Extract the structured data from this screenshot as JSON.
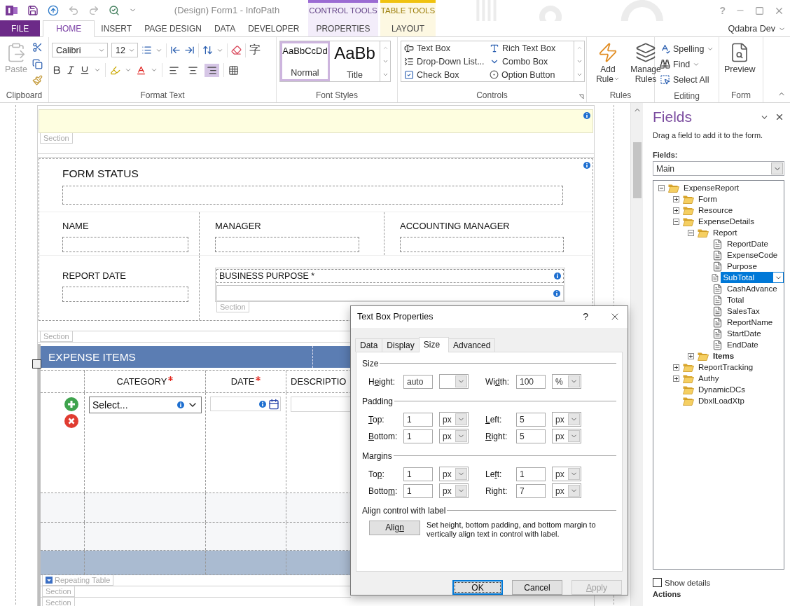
{
  "title_bar": {
    "title": "(Design) Form1 - InfoPath",
    "help": "?",
    "quick_access": [
      {
        "kind": "save",
        "disabled": false
      },
      {
        "kind": "publish",
        "disabled": false
      },
      {
        "kind": "undo",
        "disabled": true
      },
      {
        "kind": "redo",
        "disabled": true
      },
      {
        "kind": "inspect",
        "disabled": false
      }
    ]
  },
  "tabs": [
    {
      "label": "FILE",
      "kind": "file",
      "selected": false
    },
    {
      "label": "HOME",
      "kind": "plain",
      "selected": true
    },
    {
      "label": "INSERT",
      "kind": "plain",
      "selected": false
    },
    {
      "label": "PAGE DESIGN",
      "kind": "plain",
      "selected": false
    },
    {
      "label": "DATA",
      "kind": "plain",
      "selected": false
    },
    {
      "label": "DEVELOPER",
      "kind": "plain",
      "selected": false
    }
  ],
  "contextual_groups": [
    {
      "label": "CONTROL TOOLS",
      "color": "#9b6bd3",
      "tabs": [
        {
          "label": "PROPERTIES",
          "selected": false
        }
      ]
    },
    {
      "label": "TABLE TOOLS",
      "color": "#f0c20f",
      "tabs": [
        {
          "label": "LAYOUT",
          "selected": false
        }
      ]
    }
  ],
  "user": "Qdabra Dev",
  "ribbon": {
    "clipboard": {
      "label": "Clipboard",
      "paste": {
        "label": "Paste",
        "disabled": true
      }
    },
    "format_text": {
      "label": "Format Text",
      "font": "Calibri",
      "size": "12",
      "cjk_glyph": "字",
      "alignments": [
        {
          "kind": "left",
          "selected": false
        },
        {
          "kind": "center",
          "selected": false
        },
        {
          "kind": "right",
          "selected": true
        }
      ]
    },
    "font_styles": {
      "label": "Font Styles",
      "styles": [
        {
          "sample": "AaBbCcDd",
          "label": "Normal",
          "kind": "normal",
          "selected": true
        },
        {
          "sample": "AaBb",
          "label": "Title",
          "kind": "title",
          "selected": false
        }
      ]
    },
    "controls": {
      "label": "Controls",
      "items": [
        {
          "label": "Text Box",
          "kind": "textbox"
        },
        {
          "label": "Rich Text Box",
          "kind": "richtext"
        },
        {
          "label": "Drop-Down List...",
          "kind": "dropdown"
        },
        {
          "label": "Combo Box",
          "kind": "combo"
        },
        {
          "label": "Check Box",
          "kind": "checkbox"
        },
        {
          "label": "Option Button",
          "kind": "option"
        }
      ]
    },
    "rules": {
      "label": "Rules",
      "items": [
        {
          "label": "Add Rule",
          "kind": "add",
          "dropdown": true
        },
        {
          "label": "Manage Rules",
          "kind": "manage",
          "dropdown": false
        }
      ]
    },
    "editing": {
      "label": "Editing",
      "items": [
        {
          "label": "Spelling",
          "kind": "spelling",
          "dropdown": true
        },
        {
          "label": "Find",
          "kind": "find",
          "dropdown": true
        },
        {
          "label": "Select All",
          "kind": "select",
          "dropdown": false
        }
      ]
    },
    "form": {
      "label": "Form",
      "preview": "Preview"
    }
  },
  "form": {
    "top_tag": "Section",
    "status": {
      "title": "FORM STATUS",
      "fields": [
        {
          "label": "NAME"
        },
        {
          "label": "MANAGER"
        },
        {
          "label": "ACCOUNTING MANAGER"
        }
      ],
      "report_date": "REPORT DATE",
      "purpose_label": "BUSINESS PURPOSE *",
      "purpose_tag": "Section",
      "tag": "Section"
    },
    "expense_table": {
      "title": "EXPENSE ITEMS",
      "columns": [
        {
          "label": "CATEGORY",
          "required": true
        },
        {
          "label": "DATE",
          "required": true
        },
        {
          "label": "DESCRIPTIO",
          "required": false
        }
      ],
      "category_value": "Select...",
      "tags": [
        "Repeating Table",
        "Section",
        "Section"
      ]
    }
  },
  "dialog": {
    "title": "Text Box Properties",
    "help": "?",
    "tabs": [
      {
        "label": "Data",
        "selected": false
      },
      {
        "label": "Display",
        "selected": false
      },
      {
        "label": "Size",
        "selected": true
      },
      {
        "label": "Advanced",
        "selected": false
      }
    ],
    "sections": [
      {
        "title": "Size",
        "rows": [
          [
            {
              "label": {
                "before": "H",
                "key": "e",
                "after": "ight:"
              },
              "value": "auto"
            },
            {
              "label": {
                "before": "Wi",
                "key": "d",
                "after": "th:"
              },
              "value": "100",
              "unit": "%"
            }
          ]
        ]
      },
      {
        "title": "Padding",
        "rows": [
          [
            {
              "label": {
                "key": "T",
                "after": "op:"
              },
              "value": "1",
              "unit": "px"
            },
            {
              "label": {
                "key": "L",
                "after": "eft:"
              },
              "value": "5",
              "unit": "px"
            }
          ],
          [
            {
              "label": {
                "key": "B",
                "after": "ottom:"
              },
              "value": "1",
              "unit": "px"
            },
            {
              "label": {
                "key": "R",
                "after": "ight:"
              },
              "value": "5",
              "unit": "px"
            }
          ]
        ]
      },
      {
        "title": "Margins",
        "rows": [
          [
            {
              "label": {
                "before": "To",
                "key": "p",
                "after": ":"
              },
              "value": "1",
              "unit": "px"
            },
            {
              "label": {
                "before": "Le",
                "key": "f",
                "after": "t:"
              },
              "value": "1",
              "unit": "px"
            }
          ],
          [
            {
              "label": {
                "before": "Botto",
                "key": "m",
                "after": ":"
              },
              "value": "1",
              "unit": "px"
            },
            {
              "label": {
                "before": "Ri",
                "key": "g",
                "after": "ht:"
              },
              "value": "7",
              "unit": "px"
            }
          ]
        ]
      }
    ],
    "align": {
      "title": "Align control with label",
      "button": {
        "before": "Alig",
        "key": "n"
      },
      "text": "Set height, bottom padding, and bottom margin to vertically align text in control with label."
    },
    "buttons": [
      {
        "label": {
          "before": "OK"
        },
        "default": true,
        "disabled": false
      },
      {
        "label": {
          "before": "Cancel"
        },
        "default": false,
        "disabled": false
      },
      {
        "label": {
          "key": "A",
          "after": "pply"
        },
        "default": false,
        "disabled": true
      }
    ]
  },
  "fields_pane": {
    "title": "Fields",
    "hint": "Drag a field to add it to the form.",
    "source_label": "Fields:",
    "source": "Main",
    "tree": [
      {
        "label": "ExpenseReport",
        "kind": "folder",
        "expanded": true,
        "selected": false,
        "children": [
          {
            "label": "Form",
            "kind": "folder",
            "expanded": false,
            "selected": false
          },
          {
            "label": "Resource",
            "kind": "folder",
            "expanded": false,
            "selected": false
          },
          {
            "label": "ExpenseDetails",
            "kind": "folder",
            "expanded": true,
            "selected": false,
            "children": [
              {
                "label": "Report",
                "kind": "folder",
                "expanded": true,
                "selected": false,
                "children": [
                  {
                    "label": "ReportDate",
                    "kind": "field",
                    "selected": false
                  },
                  {
                    "label": "ExpenseCode",
                    "kind": "field",
                    "selected": false
                  },
                  {
                    "label": "Purpose",
                    "kind": "field",
                    "selected": false
                  },
                  {
                    "label": "SubTotal",
                    "kind": "field",
                    "selected": true
                  },
                  {
                    "label": "CashAdvance",
                    "kind": "field",
                    "selected": false
                  },
                  {
                    "label": "Total",
                    "kind": "field",
                    "selected": false
                  },
                  {
                    "label": "SalesTax",
                    "kind": "field",
                    "selected": false
                  },
                  {
                    "label": "ReportName",
                    "kind": "field",
                    "selected": false
                  },
                  {
                    "label": "StartDate",
                    "kind": "field",
                    "selected": false
                  },
                  {
                    "label": "EndDate",
                    "kind": "field",
                    "selected": false
                  }
                ]
              },
              {
                "label": "Items",
                "kind": "repeating",
                "expanded": false,
                "selected": false
              }
            ]
          },
          {
            "label": "ReportTracking",
            "kind": "folder",
            "expanded": false,
            "selected": false
          },
          {
            "label": "Authy",
            "kind": "folder",
            "expanded": false,
            "selected": false
          },
          {
            "label": "DynamicDCs",
            "kind": "empty_folder",
            "selected": false
          },
          {
            "label": "DbxlLoadXtp",
            "kind": "empty_folder",
            "selected": false
          }
        ]
      }
    ],
    "show_details": {
      "label": "Show details",
      "checked": false
    },
    "actions": "Actions"
  }
}
